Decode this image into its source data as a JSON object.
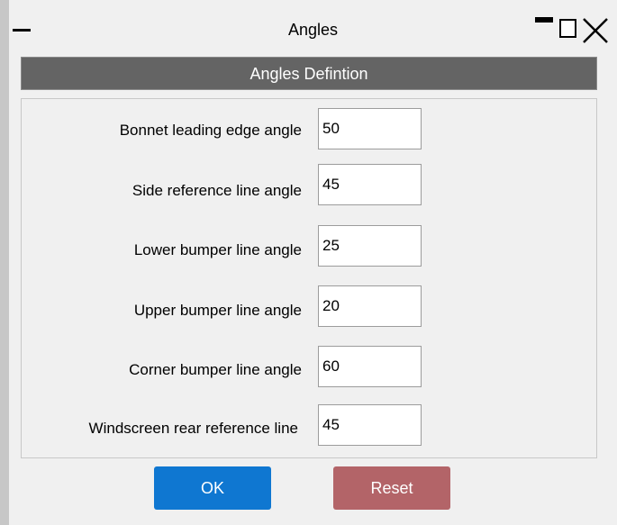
{
  "window": {
    "title": "Angles"
  },
  "header": {
    "title": "Angles Defintion"
  },
  "rows": [
    {
      "label": "Bonnet leading edge angle",
      "value": "50"
    },
    {
      "label": "Side reference line angle",
      "value": "45"
    },
    {
      "label": "Lower bumper line angle",
      "value": "25"
    },
    {
      "label": "Upper bumper line angle",
      "value": "20"
    },
    {
      "label": "Corner bumper line angle",
      "value": "60"
    },
    {
      "label": "Windscreen rear reference line",
      "value": "45"
    }
  ],
  "buttons": {
    "ok": "OK",
    "reset": "Reset"
  },
  "icons": {
    "menu": "dash-icon",
    "minimize": "minimize-icon",
    "maximize": "maximize-icon",
    "close": "close-icon"
  },
  "colors": {
    "header_bg": "#646464",
    "ok_button": "#0f77d1",
    "reset_button": "#b36468"
  }
}
